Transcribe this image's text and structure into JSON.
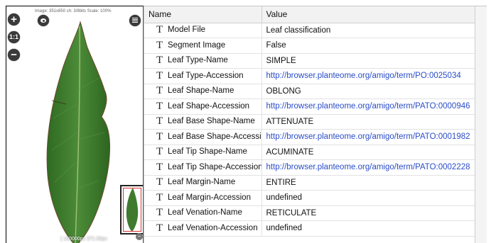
{
  "viewer": {
    "info_text": "Image: 351x850 ch: 3/8bits Scale: 100%",
    "zoom_in_label": "+",
    "reset_label": "1:1",
    "zoom_out_label": "−",
    "nav_close_label": "−",
    "coordinate_text": "( 100000px 371.90px"
  },
  "table": {
    "columns": [
      "Name",
      "Value"
    ],
    "type_icon_glyph": "T",
    "rows": [
      {
        "name": "Model File",
        "value": "Leaf classification"
      },
      {
        "name": "Segment Image",
        "value": "False"
      },
      {
        "name": "Leaf Type-Name",
        "value": "SIMPLE"
      },
      {
        "name": "Leaf Type-Accession",
        "value": "http://browser.planteome.org/amigo/term/PO:0025034"
      },
      {
        "name": "Leaf Shape-Name",
        "value": "OBLONG"
      },
      {
        "name": "Leaf Shape-Accession",
        "value": "http://browser.planteome.org/amigo/term/PATO:0000946"
      },
      {
        "name": "Leaf Base Shape-Name",
        "value": "ATTENUATE"
      },
      {
        "name": "Leaf Base Shape-Accession",
        "value": "http://browser.planteome.org/amigo/term/PATO:0001982"
      },
      {
        "name": "Leaf Tip Shape-Name",
        "value": "ACUMINATE"
      },
      {
        "name": "Leaf Tip Shape-Accession",
        "value": "http://browser.planteome.org/amigo/term/PATO:0002228"
      },
      {
        "name": "Leaf Margin-Name",
        "value": "ENTIRE"
      },
      {
        "name": "Leaf Margin-Accession",
        "value": "undefined"
      },
      {
        "name": "Leaf Venation-Name",
        "value": "RETICULATE"
      },
      {
        "name": "Leaf Venation-Accession",
        "value": "undefined"
      }
    ]
  },
  "colors": {
    "link": "#2a4dc7",
    "leaf": "#3f7a2e",
    "navigator_viewport": "#dd3333"
  }
}
